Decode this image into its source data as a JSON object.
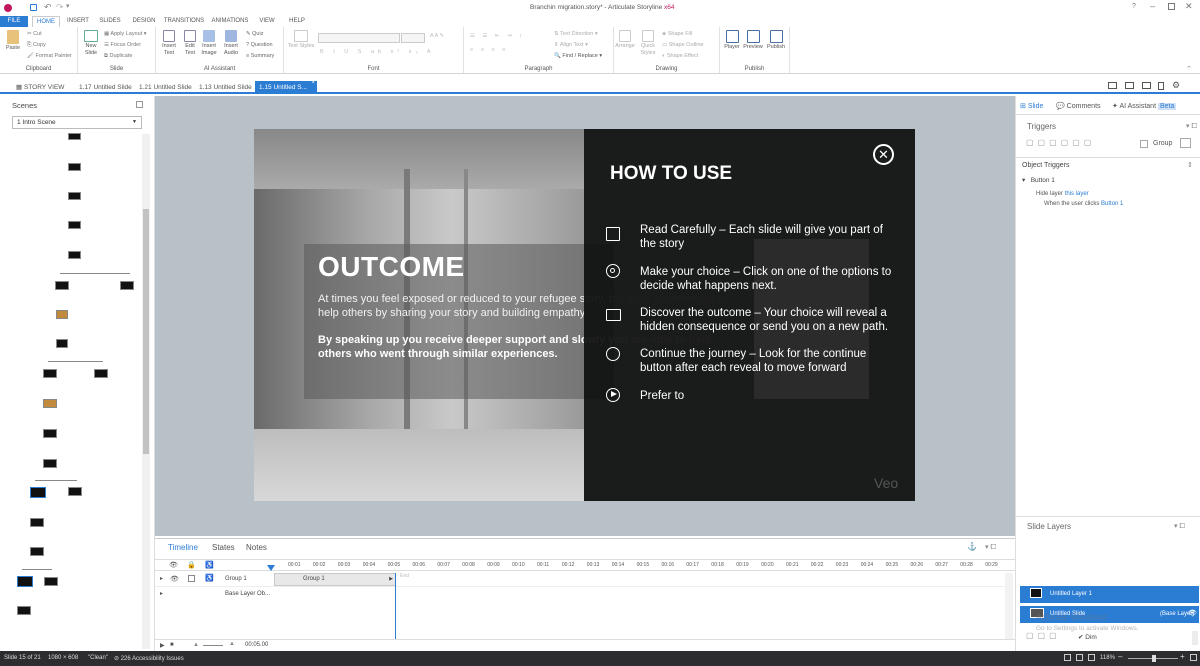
{
  "titlebar": {
    "title": "Branchin migration.story* - Articulate Storyline",
    "arch": "x64",
    "help": "?"
  },
  "tabs": [
    "FILE",
    "HOME",
    "INSERT",
    "SLIDES",
    "DESIGN",
    "TRANSITIONS",
    "ANIMATIONS",
    "VIEW",
    "HELP"
  ],
  "ribbon": {
    "paste": "Paste",
    "cut": "Cut",
    "copy": "Copy",
    "format_painter": "Format Painter",
    "clipboard": "Clipboard",
    "new_slide": "New\nSlide",
    "apply_layout": "Apply Layout",
    "focus_order": "Focus Order",
    "duplicate": "Duplicate",
    "slide": "Slide",
    "insert_text": "Insert\nText",
    "edit_text": "Edit\nText",
    "insert_image": "Insert\nImage",
    "insert_audio": "Insert\nAudio",
    "quiz": "Quiz",
    "question": "Question",
    "summary": "Summary",
    "ai_assistant": "AI Assistant",
    "text_styles": "Text Styles",
    "font": "Font",
    "text_direction": "Text Direction",
    "align_text": "Align Text",
    "find_replace": "Find / Replace",
    "paragraph": "Paragraph",
    "arrange": "Arrange",
    "quick_styles": "Quick\nStyles",
    "shape_fill": "Shape Fill",
    "shape_outline": "Shape Outline",
    "shape_effect": "Shape Effect",
    "drawing": "Drawing",
    "player": "Player",
    "preview": "Preview",
    "publish_btn": "Publish",
    "publish": "Publish"
  },
  "doctabs": {
    "story_view": "STORY VIEW",
    "tabs": [
      "1.17 Untitled Slide",
      "1.21 Untitled Slide",
      "1.13 Untitled Slide",
      "1.15 Untitled S..."
    ],
    "close": "×"
  },
  "scenes": {
    "title": "Scenes",
    "selected": "1 Intro Scene"
  },
  "slide": {
    "outcome_title": "OUTCOME",
    "outcome_p1": "At times you feel exposed or reduced to your refugee story, but also, you manage to help others by sharing your story and building empathy.",
    "outcome_p2": "By speaking up you receive deeper support and slowly you are able to help others who went through similar experiences.",
    "panel_title": "HOW TO USE",
    "items": [
      "Read Carefully – Each slide will give you part of the story",
      "Make your choice – Click on one of the options to decide what happens next.",
      "Discover the outcome – Your choice will reveal a hidden consequence or send you on a new path.",
      "Continue the journey – Look for the continue button after each reveal to move forward",
      "Prefer to"
    ],
    "watermark": "Veo"
  },
  "timeline": {
    "tabs": [
      "Timeline",
      "States",
      "Notes"
    ],
    "ticks": [
      "00:01",
      "00:02",
      "00:03",
      "00:04",
      "00:05",
      "00:06",
      "00:07",
      "00:08",
      "00:09",
      "00:10",
      "00:11",
      "00:12",
      "00:13",
      "00:14",
      "00:15",
      "00:16",
      "00:17",
      "00:18",
      "00:19",
      "00:20",
      "00:21",
      "00:22",
      "00:23",
      "00:24",
      "00:25",
      "00:26",
      "00:27",
      "00:28",
      "00:29"
    ],
    "row1": "Group 1",
    "row1_bar": "Group 1",
    "end": "End",
    "row2": "Base Layer Ob...",
    "time": "00:05.00"
  },
  "right": {
    "tabs": [
      "Slide",
      "Comments",
      "AI Assistant"
    ],
    "beta": "Beta",
    "triggers": "Triggers",
    "group": "Group",
    "object_triggers": "Object Triggers",
    "button": "Button 1",
    "action_a": "Hide layer",
    "action_b": "this layer",
    "when_a": "When the user clicks",
    "when_b": "Button 1",
    "slide_layers": "Slide Layers",
    "layer1": "Untitled Layer 1",
    "base": "Untitled Slide",
    "base_tag": "(Base Layer)",
    "dim": "Dim",
    "activate": "Activate Windows",
    "activate_sub": "Go to Settings to activate Windows."
  },
  "status": {
    "slide": "Slide 15 of 21",
    "size": "1080 × 608",
    "clean": "\"Clean\"",
    "access": "226 Accessibility Issues",
    "zoom": "118%"
  },
  "colors": {
    "accent": "#2b7cd3",
    "dark_panel": "#0e0e0e",
    "status": "#2d2d30"
  }
}
